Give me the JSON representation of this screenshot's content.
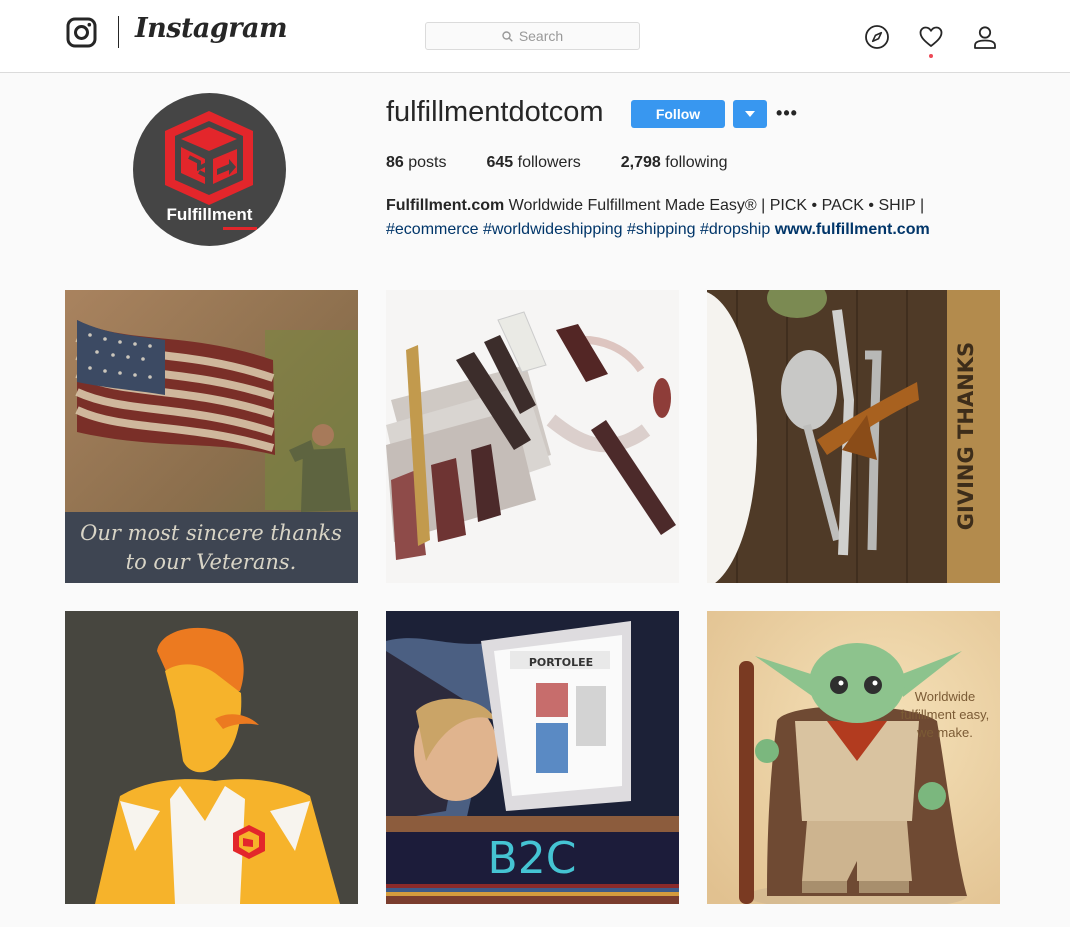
{
  "header": {
    "wordmark": "Instagram",
    "search_placeholder": "Search",
    "icons": [
      "instagram-glyph-icon",
      "search-icon",
      "compass-icon",
      "heart-icon",
      "person-icon"
    ]
  },
  "profile": {
    "username": "fulfillmentdotcom",
    "avatar_label": "Fulfillment",
    "follow_label": "Follow",
    "more_label": "•••",
    "stats": {
      "posts_count": "86",
      "posts_label": " posts",
      "followers_count": "645",
      "followers_label": " followers",
      "following_count": "2,798",
      "following_label": " following"
    },
    "bio": {
      "name": "Fulfillment.com",
      "text": " Worldwide Fulfillment Made Easy® | PICK • PACK • SHIP |",
      "tags": [
        "#ecommerce",
        "#worldwideshipping",
        "#shipping",
        "#dropship"
      ],
      "link": "www.fulfillment.com"
    }
  },
  "posts": [
    {
      "caption_line1": "Our most sincere thanks",
      "caption_line2": "to our Veterans."
    },
    {
      "caption_line1": ""
    },
    {
      "side_text": "GIVING THANKS"
    },
    {
      "caption_line1": ""
    },
    {
      "caption_line1": "B2C",
      "tablet_text": "PORTOLEE"
    },
    {
      "caption_line1": "Worldwide",
      "caption_line2": "fulfillment easy,",
      "caption_line3": "we make."
    }
  ],
  "colors": {
    "accent": "#3897f0",
    "border": "#dbdbdb",
    "background": "#fafafa",
    "link": "#003569",
    "notification": "#ed4956",
    "brand_red": "#e3262b"
  }
}
